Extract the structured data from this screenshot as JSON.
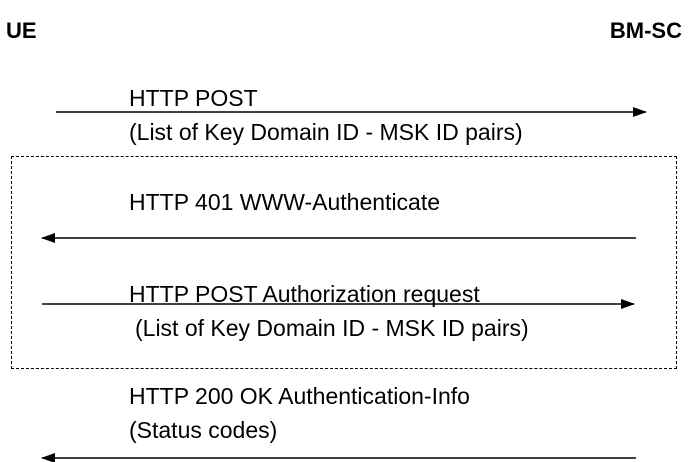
{
  "endpoints": {
    "ue": "UE",
    "bmsc": "BM-SC"
  },
  "messages": [
    {
      "line1": "HTTP POST",
      "line2": "(List of Key Domain ID - MSK ID pairs)",
      "direction": "UE→BM-SC"
    },
    {
      "line1": "HTTP 401 WWW-Authenticate",
      "direction": "BM-SC→UE"
    },
    {
      "line1": "HTTP POST Authorization request",
      "line2": "(List of Key Domain ID - MSK ID pairs)",
      "direction": "UE→BM-SC"
    },
    {
      "line1": "HTTP 200 OK Authentication-Info",
      "line2": "(Status codes)",
      "direction": "BM-SC→UE"
    }
  ],
  "colors": {
    "line": "#000000",
    "background": "#ffffff"
  }
}
